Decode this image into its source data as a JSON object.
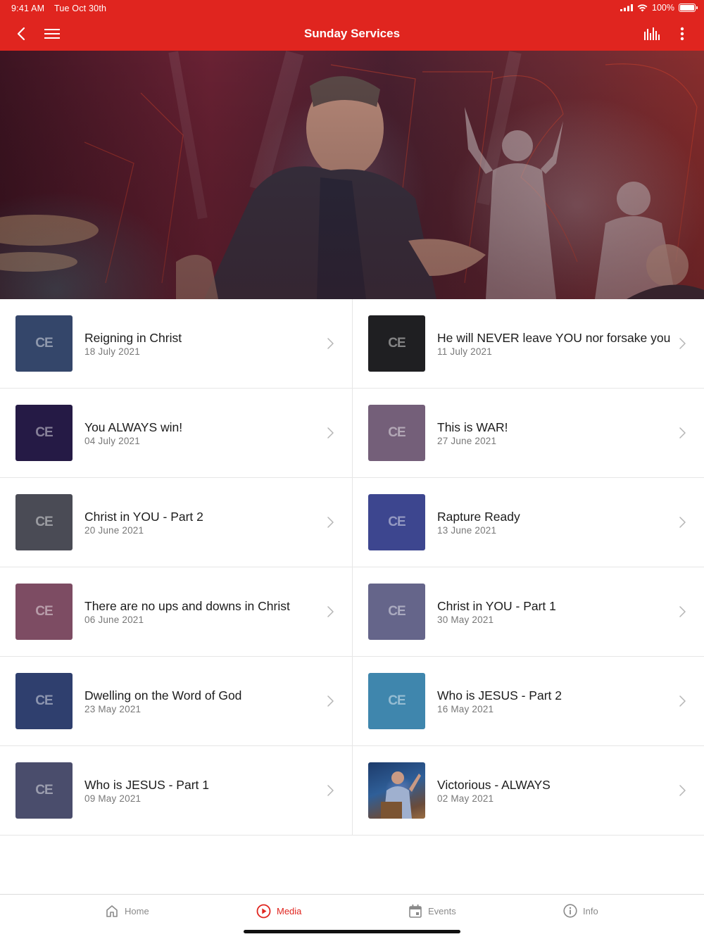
{
  "status_bar": {
    "time": "9:41 AM",
    "date": "Tue Oct 30th",
    "battery": "100%"
  },
  "nav": {
    "title": "Sunday Services"
  },
  "colors": {
    "brand": "#e0251f",
    "inactive": "#8a8a8a"
  },
  "sermons": [
    {
      "title": "Reigning in Christ",
      "date": "18 July 2021",
      "thumb_color": "#34466a",
      "thumb_type": "logo",
      "thumb_logo": "CE"
    },
    {
      "title": "He will NEVER leave YOU nor forsake you",
      "date": "11 July 2021",
      "thumb_color": "#1f1f22",
      "thumb_type": "logo",
      "thumb_logo": "CE"
    },
    {
      "title": "You ALWAYS win!",
      "date": "04 July 2021",
      "thumb_color": "#251a45",
      "thumb_type": "logo",
      "thumb_logo": "CE"
    },
    {
      "title": "This is WAR!",
      "date": "27 June 2021",
      "thumb_color": "#745f79",
      "thumb_type": "logo",
      "thumb_logo": "CE"
    },
    {
      "title": "Christ in YOU - Part 2",
      "date": "20 June 2021",
      "thumb_color": "#4a4b55",
      "thumb_type": "logo",
      "thumb_logo": "CE"
    },
    {
      "title": "Rapture Ready",
      "date": "13 June 2021",
      "thumb_color": "#3d468f",
      "thumb_type": "logo",
      "thumb_logo": "CE"
    },
    {
      "title": "There are no ups and downs in Christ",
      "date": "06 June 2021",
      "thumb_color": "#7d4c63",
      "thumb_type": "logo",
      "thumb_logo": "CE"
    },
    {
      "title": "Christ in YOU - Part 1",
      "date": "30 May 2021",
      "thumb_color": "#65658a",
      "thumb_type": "logo",
      "thumb_logo": "CE"
    },
    {
      "title": "Dwelling on the Word of God",
      "date": "23 May 2021",
      "thumb_color": "#2f3f6e",
      "thumb_type": "logo",
      "thumb_logo": "CE"
    },
    {
      "title": "Who is JESUS - Part 2",
      "date": "16 May 2021",
      "thumb_color": "#3f86ad",
      "thumb_type": "logo",
      "thumb_logo": "CE"
    },
    {
      "title": "Who is JESUS - Part 1",
      "date": "09 May 2021",
      "thumb_color": "#4a4d6c",
      "thumb_type": "logo",
      "thumb_logo": "CE"
    },
    {
      "title": "Victorious - ALWAYS",
      "date": "02 May 2021",
      "thumb_color": "#2d5f8f",
      "thumb_type": "photo"
    }
  ],
  "tabs": [
    {
      "label": "Home",
      "icon": "home-icon",
      "active": false
    },
    {
      "label": "Media",
      "icon": "play-circle-icon",
      "active": true
    },
    {
      "label": "Events",
      "icon": "calendar-icon",
      "active": false
    },
    {
      "label": "Info",
      "icon": "info-icon",
      "active": false
    }
  ]
}
